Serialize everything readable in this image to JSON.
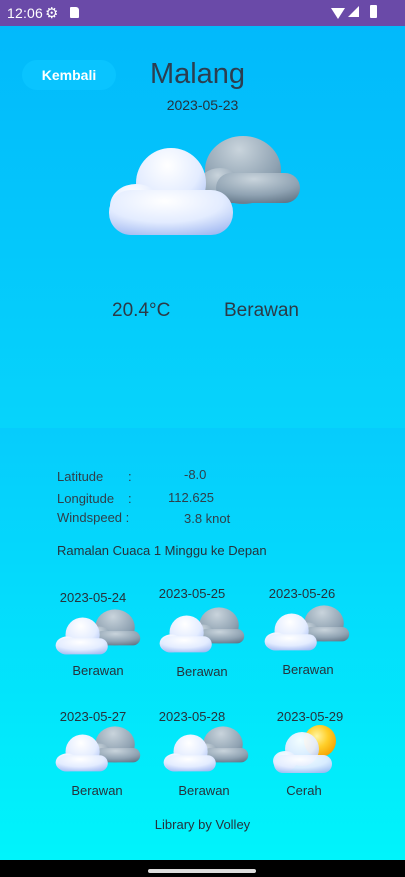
{
  "status": {
    "time": "12:06",
    "icons": [
      "gear-icon",
      "sd-card-icon",
      "wifi-icon",
      "signal-icon",
      "battery-icon"
    ]
  },
  "header": {
    "back_label": "Kembali",
    "city": "Malang",
    "date": "2023-05-23"
  },
  "current": {
    "temperature": "20.4°C",
    "condition": "Berawan",
    "icon": "cloudy-icon"
  },
  "info": {
    "latitude_label": "Latitude",
    "latitude_colon": ":",
    "latitude_value": "-8.0",
    "longitude_label": "Longitude",
    "longitude_colon": ":",
    "longitude_value": "112.625",
    "windspeed_label": "Windspeed :",
    "windspeed_value": "3.8 knot"
  },
  "forecast": {
    "title": "Ramalan Cuaca 1 Minggu ke Depan",
    "days": [
      {
        "date": "2023-05-24",
        "condition": "Berawan",
        "icon": "cloudy-icon"
      },
      {
        "date": "2023-05-25",
        "condition": "Berawan",
        "icon": "cloudy-icon"
      },
      {
        "date": "2023-05-26",
        "condition": "Berawan",
        "icon": "cloudy-icon"
      },
      {
        "date": "2023-05-27",
        "condition": "Berawan",
        "icon": "cloudy-icon"
      },
      {
        "date": "2023-05-28",
        "condition": "Berawan",
        "icon": "cloudy-icon"
      },
      {
        "date": "2023-05-29",
        "condition": "Cerah",
        "icon": "sunny-cloud-icon"
      }
    ]
  },
  "footer": {
    "text": "Library by Volley"
  },
  "colors": {
    "status_bar": "#6a4aa8",
    "top_bg": "#02b9fb",
    "bottom_bg": "#00f4fb",
    "button": "#09c4ff"
  }
}
